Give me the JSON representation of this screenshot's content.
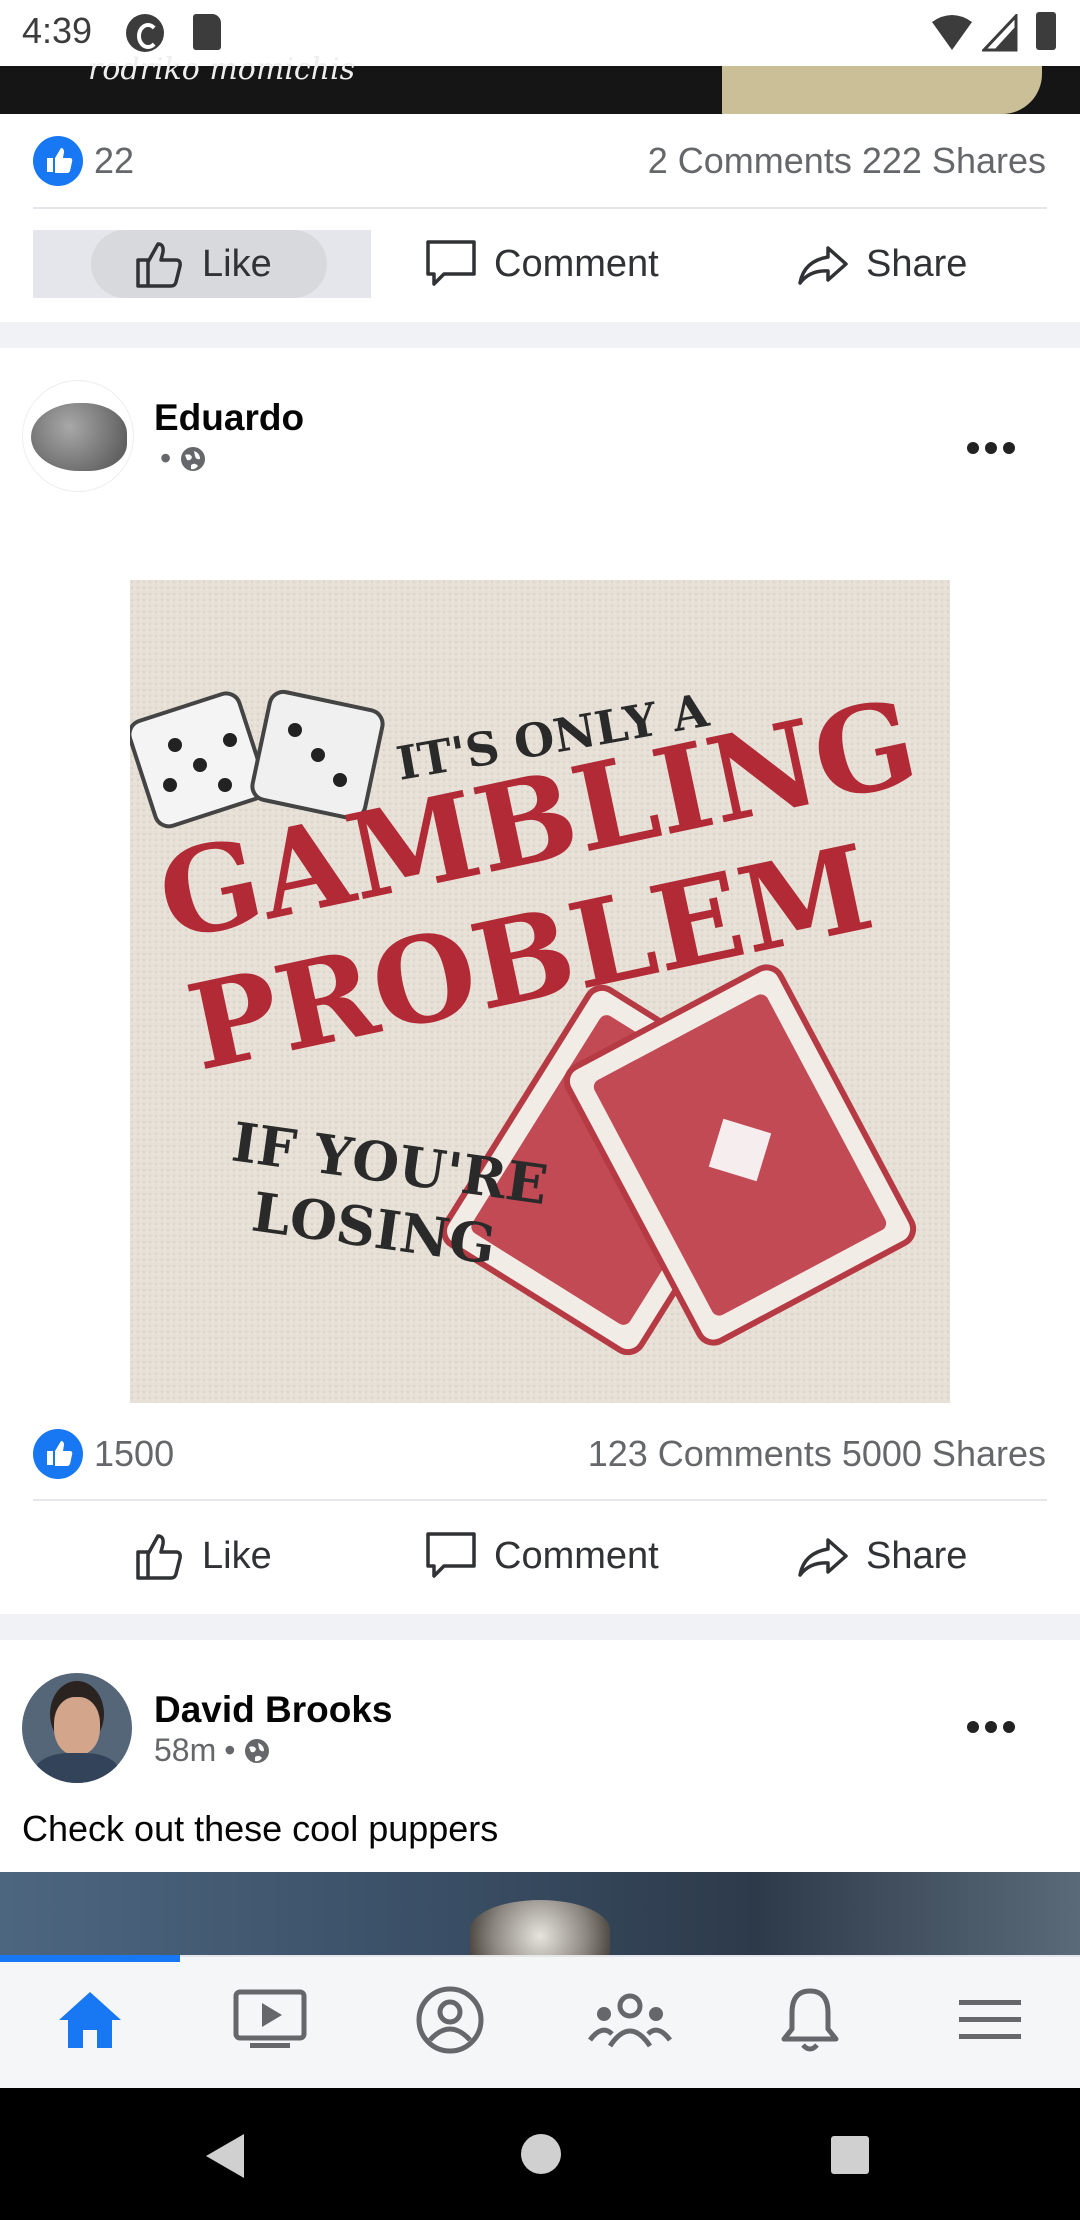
{
  "status_bar": {
    "time": "4:39"
  },
  "previous_post": {
    "image_caption": "rodriko momichis",
    "like_count": "22",
    "comments": "2 Comments",
    "shares": "222 Shares",
    "actions": {
      "like": "Like",
      "comment": "Comment",
      "share": "Share"
    }
  },
  "post": {
    "author": "Eduardo",
    "meta": "•",
    "image": {
      "line1": "IT'S ONLY A",
      "line2": "GAMBLING",
      "line3": "PROBLEM",
      "line4": "IF YOU'RE",
      "line5": "LOSING"
    },
    "like_count": "1500",
    "comments": "123 Comments",
    "shares": "5000 Shares",
    "actions": {
      "like": "Like",
      "comment": "Comment",
      "share": "Share"
    }
  },
  "next_post": {
    "author": "David Brooks",
    "time": "58m",
    "meta_sep": "•",
    "text": "Check out these cool puppers"
  },
  "colors": {
    "accent": "#1877f2",
    "like_pressed_bg": "#e4e6eb"
  },
  "icons": {
    "status": [
      "pocket-casts-icon",
      "sd-card-icon",
      "wifi-icon",
      "signal-icon",
      "battery-icon"
    ],
    "nav": [
      "home-icon",
      "watch-icon",
      "profile-icon",
      "groups-icon",
      "notifications-icon",
      "menu-icon"
    ]
  }
}
